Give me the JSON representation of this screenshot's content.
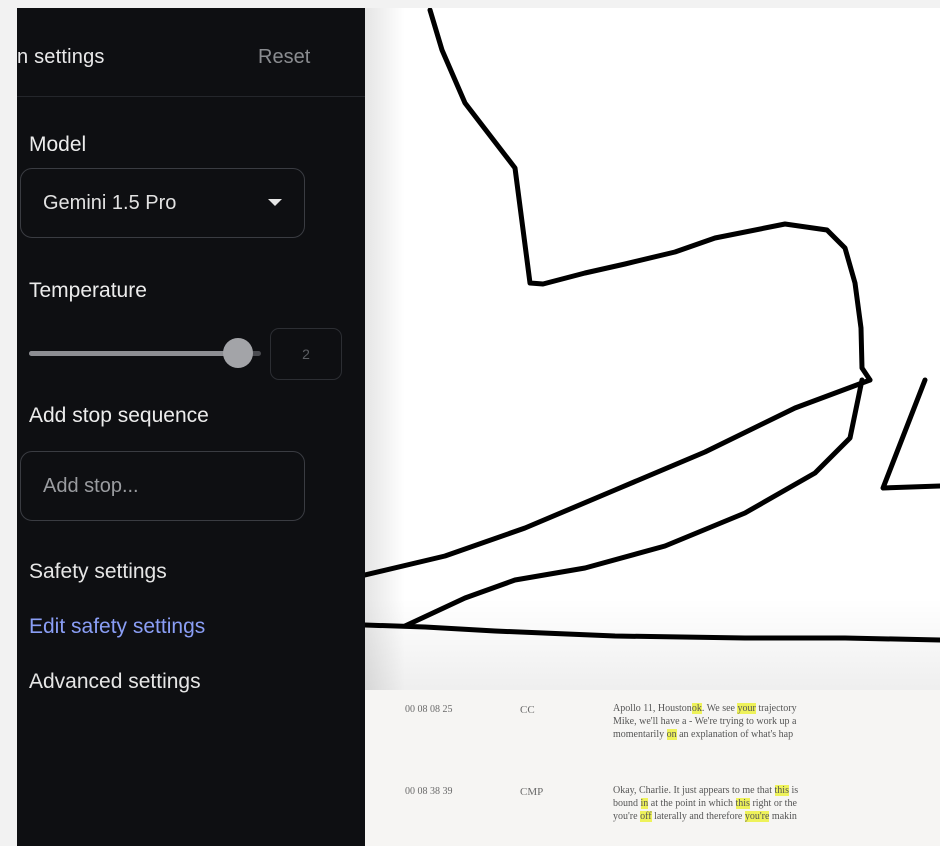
{
  "panel": {
    "title": "n settings",
    "reset_label": "Reset",
    "model": {
      "label": "Model",
      "selected": "Gemini 1.5 Pro"
    },
    "temperature": {
      "label": "Temperature",
      "value": "2",
      "slider_fraction": 0.9
    },
    "stop_sequence": {
      "label": "Add stop sequence",
      "placeholder": "Add stop..."
    },
    "safety": {
      "heading": "Safety settings",
      "edit_link": "Edit safety settings"
    },
    "advanced_label": "Advanced settings"
  },
  "transcript": {
    "rows": [
      {
        "time": "00 08 08 25",
        "speaker": "CC",
        "lines": [
          [
            {
              "t": "Apollo 11, Houston"
            },
            {
              "t": "ok",
              "h": true
            },
            {
              "t": ". We see "
            },
            {
              "t": "your",
              "h": true
            },
            {
              "t": " trajectory"
            }
          ],
          [
            {
              "t": "Mike, we'll have a - We're trying to work up a"
            }
          ],
          [
            {
              "t": "momentarily "
            },
            {
              "t": "on",
              "h": true
            },
            {
              "t": " an explanation of what's hap"
            }
          ]
        ]
      },
      {
        "time": "00 08 38 39",
        "speaker": "CMP",
        "lines": [
          [
            {
              "t": "Okay, Charlie. It just appears to me that "
            },
            {
              "t": "this",
              "h": true
            },
            {
              "t": " is"
            }
          ],
          [
            {
              "t": "bound "
            },
            {
              "t": "in",
              "h": true
            },
            {
              "t": " at the point in which "
            },
            {
              "t": "this",
              "h": true
            },
            {
              "t": " right or the"
            }
          ],
          [
            {
              "t": "you're "
            },
            {
              "t": "off",
              "h": true
            },
            {
              "t": " laterally and therefore "
            },
            {
              "t": "you're",
              "h": true
            },
            {
              "t": " makin"
            }
          ]
        ]
      }
    ]
  },
  "colors": {
    "panel_bg": "#0e0f12",
    "link": "#8a9ef5",
    "highlight": "#eef25a"
  }
}
